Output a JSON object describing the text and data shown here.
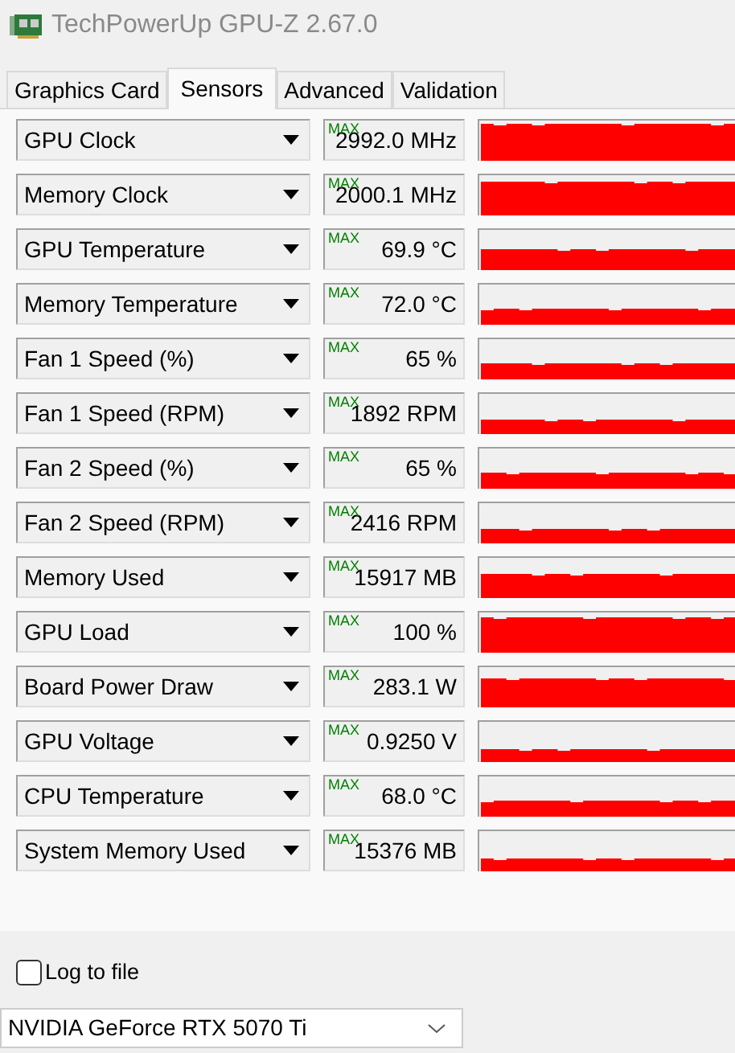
{
  "window": {
    "title": "TechPowerUp GPU-Z 2.67.0"
  },
  "tabs": [
    {
      "label": "Graphics Card",
      "selected": false
    },
    {
      "label": "Sensors",
      "selected": true
    },
    {
      "label": "Advanced",
      "selected": false
    },
    {
      "label": "Validation",
      "selected": false
    }
  ],
  "sensors": [
    {
      "name": "GPU Clock",
      "max_label": "MAX",
      "value": "2992.0 MHz"
    },
    {
      "name": "Memory Clock",
      "max_label": "MAX",
      "value": "2000.1 MHz"
    },
    {
      "name": "GPU Temperature",
      "max_label": "MAX",
      "value": "69.9 °C"
    },
    {
      "name": "Memory Temperature",
      "max_label": "MAX",
      "value": "72.0 °C"
    },
    {
      "name": "Fan 1 Speed (%)",
      "max_label": "MAX",
      "value": "65 %"
    },
    {
      "name": "Fan 1 Speed (RPM)",
      "max_label": "MAX",
      "value": "1892 RPM"
    },
    {
      "name": "Fan 2 Speed (%)",
      "max_label": "MAX",
      "value": "65 %"
    },
    {
      "name": "Fan 2 Speed (RPM)",
      "max_label": "MAX",
      "value": "2416 RPM"
    },
    {
      "name": "Memory Used",
      "max_label": "MAX",
      "value": "15917 MB"
    },
    {
      "name": "GPU Load",
      "max_label": "MAX",
      "value": "100 %"
    },
    {
      "name": "Board Power Draw",
      "max_label": "MAX",
      "value": "283.1 W"
    },
    {
      "name": "GPU Voltage",
      "max_label": "MAX",
      "value": "0.9250 V"
    },
    {
      "name": "CPU Temperature",
      "max_label": "MAX",
      "value": "68.0 °C"
    },
    {
      "name": "System Memory Used",
      "max_label": "MAX",
      "value": "15376 MB"
    }
  ],
  "log_to_file": {
    "label": "Log to file",
    "checked": false
  },
  "device_select": {
    "value": "NVIDIA GeForce RTX 5070 Ti"
  }
}
